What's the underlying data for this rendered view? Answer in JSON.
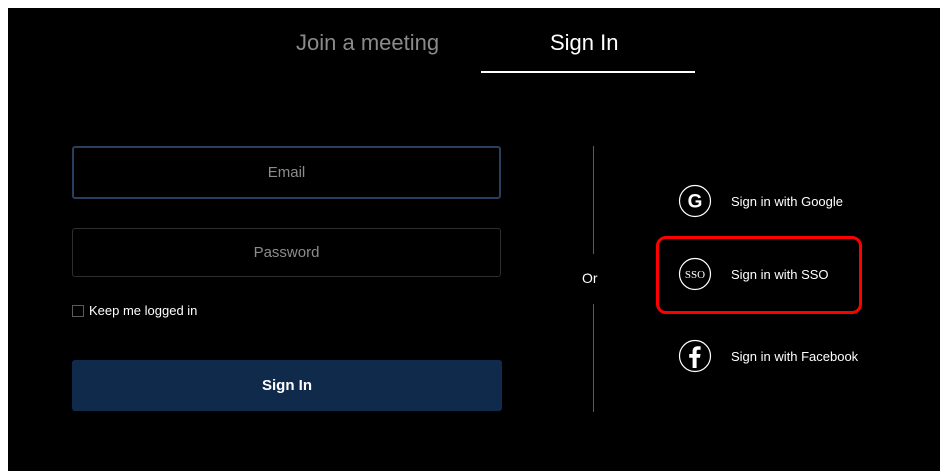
{
  "tabs": {
    "join": "Join a meeting",
    "signin": "Sign In"
  },
  "form": {
    "email_placeholder": "Email",
    "password_placeholder": "Password",
    "keep_logged_in": "Keep me logged in",
    "submit_label": "Sign In"
  },
  "divider": {
    "label": "Or"
  },
  "social": {
    "google": {
      "label": "Sign in with Google",
      "icon": "google-icon"
    },
    "sso": {
      "label": "Sign in with SSO",
      "icon": "sso-icon",
      "icon_text": "SSO"
    },
    "facebook": {
      "label": "Sign in with Facebook",
      "icon": "facebook-icon"
    }
  },
  "colors": {
    "background": "#000000",
    "button": "#0f2a4a",
    "highlight": "#ff0000",
    "inactive_tab": "#8a8a8a"
  }
}
